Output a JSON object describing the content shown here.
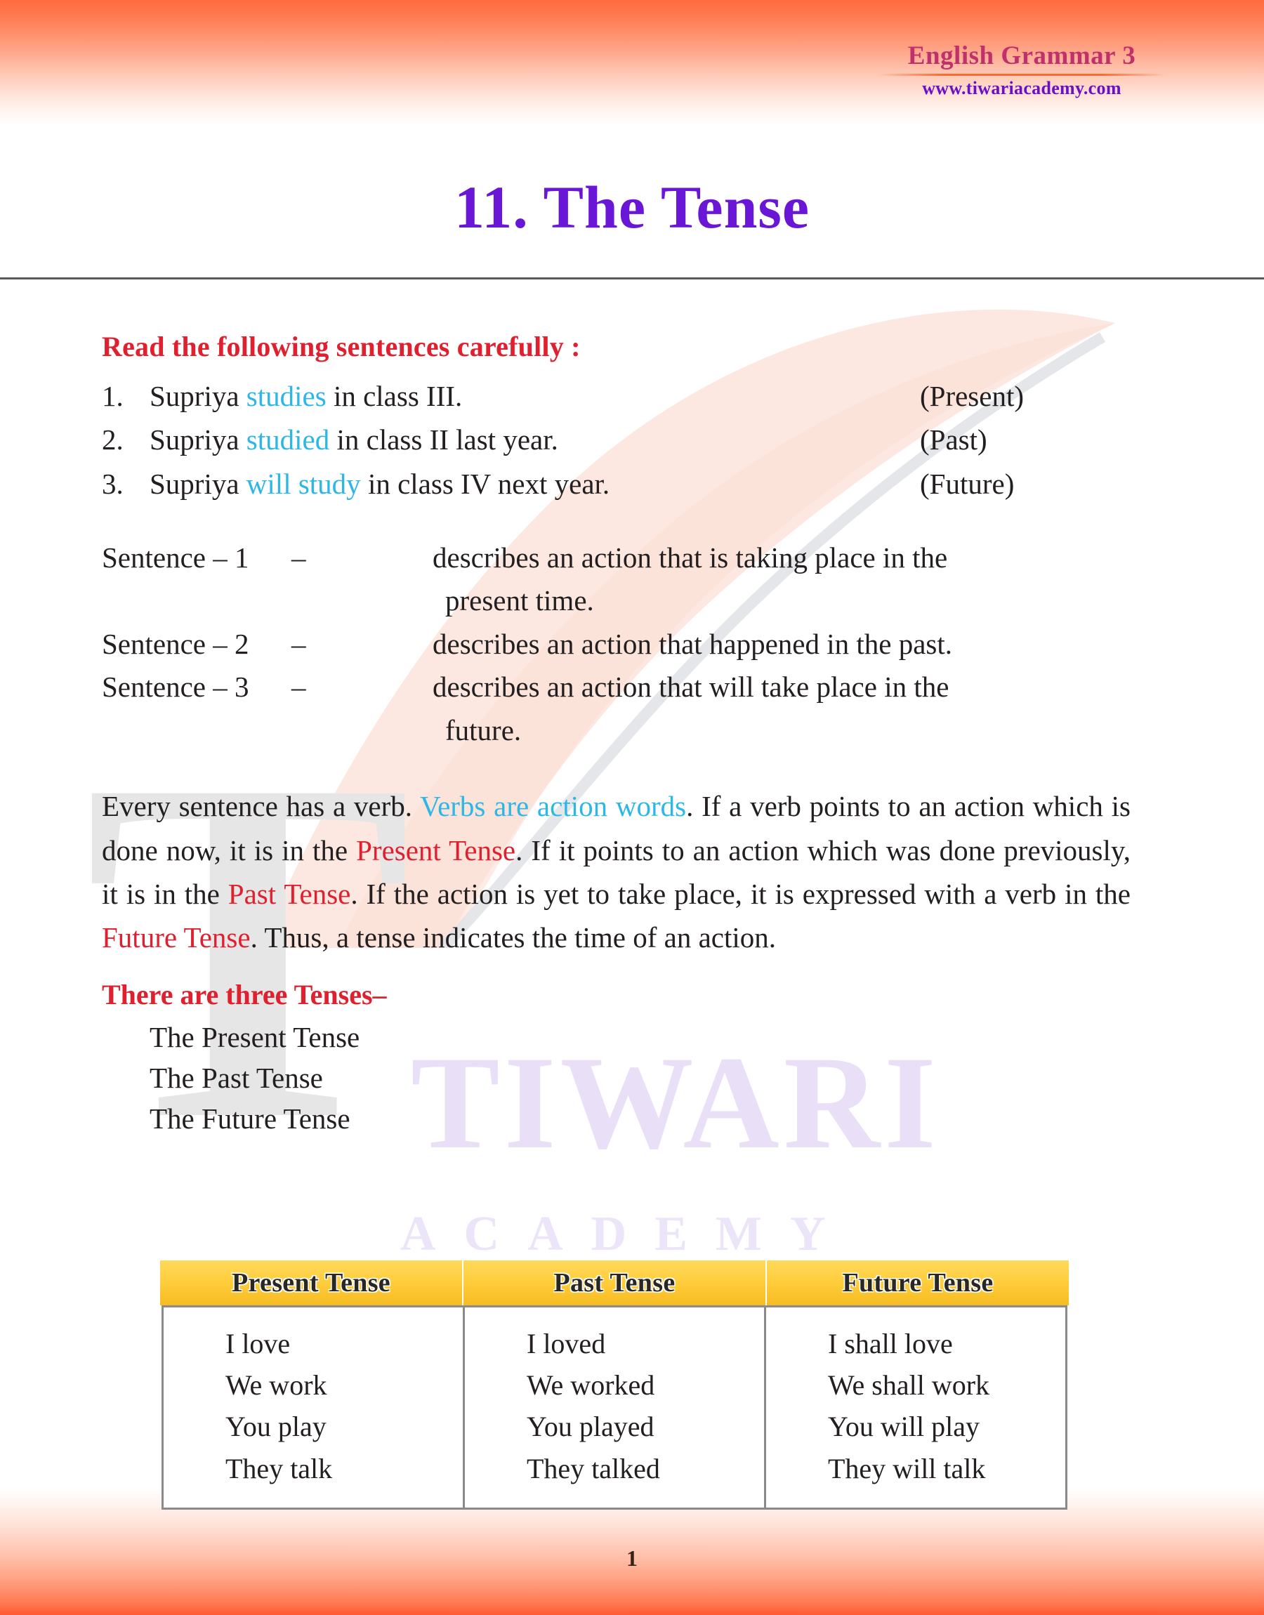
{
  "header": {
    "brand_title": "English Grammar 3",
    "brand_url": "www.tiwariacademy.com"
  },
  "title": "11. The Tense",
  "section_heading": "Read the following sentences carefully :",
  "sentences": [
    {
      "num": "1.",
      "before": "Supriya ",
      "verb": "studies",
      "after": " in class III.",
      "tag": "(Present)"
    },
    {
      "num": "2.",
      "before": "Supriya ",
      "verb": "studied",
      "after": " in class II last year.",
      "tag": "(Past)"
    },
    {
      "num": "3.",
      "before": "Supriya ",
      "verb": "will study",
      "after": " in class IV next year.",
      "tag": "(Future)"
    }
  ],
  "descriptions": [
    {
      "label": "Sentence – 1",
      "dash": "–",
      "text": "describes an action that is taking place in the",
      "cont": "present time."
    },
    {
      "label": "Sentence – 2",
      "dash": "–",
      "text": "describes an action that happened in the past.",
      "cont": ""
    },
    {
      "label": "Sentence – 3",
      "dash": "–",
      "text": "describes an action that will take place in the",
      "cont": "future."
    }
  ],
  "paragraph": {
    "p1": "Every sentence has a verb. ",
    "blue1": "Verbs are action words",
    "p2": ". If a verb points to an action which is done now, it is in the ",
    "red1": "Present Tense",
    "p3": ". If it points to an action which was done previously, it is in the ",
    "red2": "Past Tense",
    "p4": ". If the action is yet to take place, it is expressed with a verb in the ",
    "red3": "Future Tense",
    "p5": ". Thus, a tense indicates the time of an action."
  },
  "three_tenses_heading": "There are three Tenses–",
  "three_tenses": [
    "The Present Tense",
    "The Past Tense",
    "The Future Tense"
  ],
  "table": {
    "headers": [
      "Present Tense",
      "Past Tense",
      "Future Tense"
    ],
    "columns": [
      [
        "I love",
        "We work",
        "You play",
        "They talk"
      ],
      [
        "I loved",
        "We worked",
        "You played",
        "They talked"
      ],
      [
        "I shall love",
        "We shall work",
        "You will play",
        "They will talk"
      ]
    ]
  },
  "watermark": {
    "tiwari": "TIWARI",
    "academy": "ACADEMY",
    "letter": "T"
  },
  "page_number": "1",
  "colors": {
    "title_purple": "#6a16d6",
    "brand_magenta": "#c0306a",
    "brand_url_purple": "#6a11c4",
    "accent_red": "#e0202e",
    "verb_cyan": "#2cb7e6",
    "table_gold": "#ffce3e",
    "band_orange": "#ff6a3d"
  }
}
